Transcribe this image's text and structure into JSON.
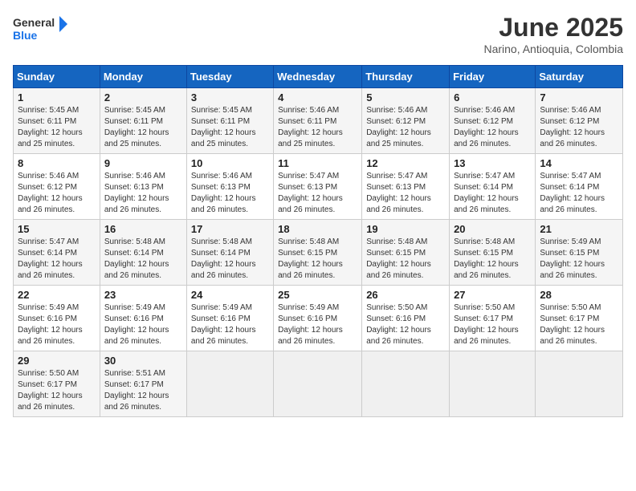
{
  "logo": {
    "line1": "General",
    "line2": "Blue"
  },
  "title": "June 2025",
  "subtitle": "Narino, Antioquia, Colombia",
  "days_of_week": [
    "Sunday",
    "Monday",
    "Tuesday",
    "Wednesday",
    "Thursday",
    "Friday",
    "Saturday"
  ],
  "weeks": [
    [
      {
        "day": "1",
        "rise": "5:45 AM",
        "set": "6:11 PM",
        "daylight": "12 hours and 25 minutes."
      },
      {
        "day": "2",
        "rise": "5:45 AM",
        "set": "6:11 PM",
        "daylight": "12 hours and 25 minutes."
      },
      {
        "day": "3",
        "rise": "5:45 AM",
        "set": "6:11 PM",
        "daylight": "12 hours and 25 minutes."
      },
      {
        "day": "4",
        "rise": "5:46 AM",
        "set": "6:11 PM",
        "daylight": "12 hours and 25 minutes."
      },
      {
        "day": "5",
        "rise": "5:46 AM",
        "set": "6:12 PM",
        "daylight": "12 hours and 25 minutes."
      },
      {
        "day": "6",
        "rise": "5:46 AM",
        "set": "6:12 PM",
        "daylight": "12 hours and 26 minutes."
      },
      {
        "day": "7",
        "rise": "5:46 AM",
        "set": "6:12 PM",
        "daylight": "12 hours and 26 minutes."
      }
    ],
    [
      {
        "day": "8",
        "rise": "5:46 AM",
        "set": "6:12 PM",
        "daylight": "12 hours and 26 minutes."
      },
      {
        "day": "9",
        "rise": "5:46 AM",
        "set": "6:13 PM",
        "daylight": "12 hours and 26 minutes."
      },
      {
        "day": "10",
        "rise": "5:46 AM",
        "set": "6:13 PM",
        "daylight": "12 hours and 26 minutes."
      },
      {
        "day": "11",
        "rise": "5:47 AM",
        "set": "6:13 PM",
        "daylight": "12 hours and 26 minutes."
      },
      {
        "day": "12",
        "rise": "5:47 AM",
        "set": "6:13 PM",
        "daylight": "12 hours and 26 minutes."
      },
      {
        "day": "13",
        "rise": "5:47 AM",
        "set": "6:14 PM",
        "daylight": "12 hours and 26 minutes."
      },
      {
        "day": "14",
        "rise": "5:47 AM",
        "set": "6:14 PM",
        "daylight": "12 hours and 26 minutes."
      }
    ],
    [
      {
        "day": "15",
        "rise": "5:47 AM",
        "set": "6:14 PM",
        "daylight": "12 hours and 26 minutes."
      },
      {
        "day": "16",
        "rise": "5:48 AM",
        "set": "6:14 PM",
        "daylight": "12 hours and 26 minutes."
      },
      {
        "day": "17",
        "rise": "5:48 AM",
        "set": "6:14 PM",
        "daylight": "12 hours and 26 minutes."
      },
      {
        "day": "18",
        "rise": "5:48 AM",
        "set": "6:15 PM",
        "daylight": "12 hours and 26 minutes."
      },
      {
        "day": "19",
        "rise": "5:48 AM",
        "set": "6:15 PM",
        "daylight": "12 hours and 26 minutes."
      },
      {
        "day": "20",
        "rise": "5:48 AM",
        "set": "6:15 PM",
        "daylight": "12 hours and 26 minutes."
      },
      {
        "day": "21",
        "rise": "5:49 AM",
        "set": "6:15 PM",
        "daylight": "12 hours and 26 minutes."
      }
    ],
    [
      {
        "day": "22",
        "rise": "5:49 AM",
        "set": "6:16 PM",
        "daylight": "12 hours and 26 minutes."
      },
      {
        "day": "23",
        "rise": "5:49 AM",
        "set": "6:16 PM",
        "daylight": "12 hours and 26 minutes."
      },
      {
        "day": "24",
        "rise": "5:49 AM",
        "set": "6:16 PM",
        "daylight": "12 hours and 26 minutes."
      },
      {
        "day": "25",
        "rise": "5:49 AM",
        "set": "6:16 PM",
        "daylight": "12 hours and 26 minutes."
      },
      {
        "day": "26",
        "rise": "5:50 AM",
        "set": "6:16 PM",
        "daylight": "12 hours and 26 minutes."
      },
      {
        "day": "27",
        "rise": "5:50 AM",
        "set": "6:17 PM",
        "daylight": "12 hours and 26 minutes."
      },
      {
        "day": "28",
        "rise": "5:50 AM",
        "set": "6:17 PM",
        "daylight": "12 hours and 26 minutes."
      }
    ],
    [
      {
        "day": "29",
        "rise": "5:50 AM",
        "set": "6:17 PM",
        "daylight": "12 hours and 26 minutes."
      },
      {
        "day": "30",
        "rise": "5:51 AM",
        "set": "6:17 PM",
        "daylight": "12 hours and 26 minutes."
      },
      null,
      null,
      null,
      null,
      null
    ]
  ]
}
